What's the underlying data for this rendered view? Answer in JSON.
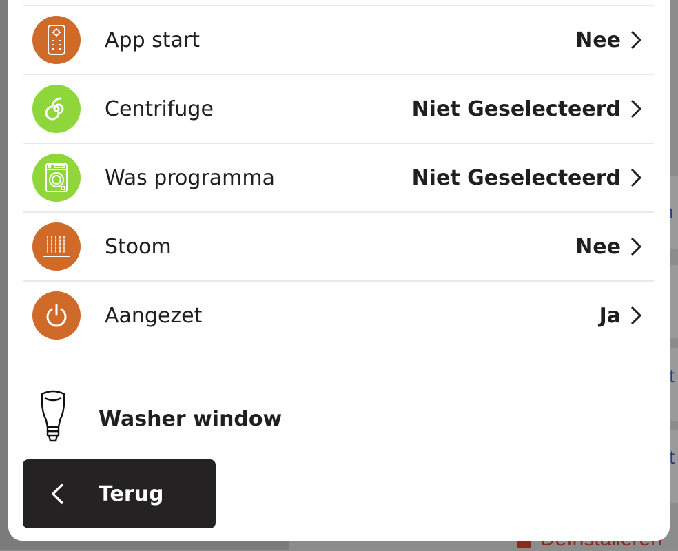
{
  "background": {
    "link_fragments": [
      "n",
      "rt",
      "rt"
    ],
    "uninstall_label": "Deïnstalleren"
  },
  "colors": {
    "orange": "#cf6a28",
    "green": "#8ed63a",
    "dark": "#242222",
    "text": "#1f1f1f"
  },
  "settings": {
    "rows": [
      {
        "label": "App start",
        "value": "Nee",
        "icon": "remote-icon",
        "color": "orange"
      },
      {
        "label": "Centrifuge",
        "value": "Niet Geselecteerd",
        "icon": "spin-icon",
        "color": "green"
      },
      {
        "label": "Was programma",
        "value": "Niet Geselecteerd",
        "icon": "washing-machine-icon",
        "color": "green"
      },
      {
        "label": "Stoom",
        "value": "Nee",
        "icon": "steam-icon",
        "color": "orange"
      },
      {
        "label": "Aangezet",
        "value": "Ja",
        "icon": "power-icon",
        "color": "orange"
      }
    ]
  },
  "device": {
    "name": "Washer window",
    "icon": "lightbulb-icon"
  },
  "footer": {
    "back_label": "Terug"
  }
}
